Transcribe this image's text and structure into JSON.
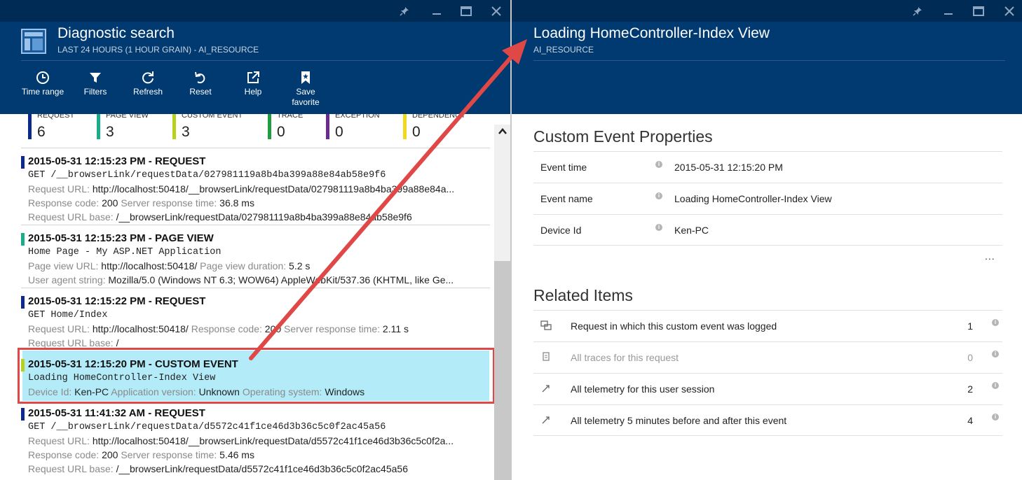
{
  "left_blade": {
    "title": "Diagnostic search",
    "subtitle": "LAST 24 HOURS (1 HOUR GRAIN) - AI_RESOURCE",
    "window_controls": [
      "pin-icon",
      "minimize-icon",
      "maximize-icon",
      "close-icon"
    ],
    "commands": [
      {
        "label": "Time range",
        "icon": "clock-icon"
      },
      {
        "label": "Filters",
        "icon": "funnel-icon"
      },
      {
        "label": "Refresh",
        "icon": "refresh-icon"
      },
      {
        "label": "Reset",
        "icon": "undo-icon"
      },
      {
        "label": "Help",
        "icon": "external-link-icon"
      },
      {
        "label": "Save favorite",
        "icon": "bookmark-star-icon"
      }
    ],
    "tiles": [
      {
        "label": "REQUEST",
        "count": "6",
        "color": "#0c2a8c"
      },
      {
        "label": "PAGE VIEW",
        "count": "3",
        "color": "#1aad8d"
      },
      {
        "label": "CUSTOM EVENT",
        "count": "3",
        "color": "#b8d11f"
      },
      {
        "label": "TRACE",
        "count": "0",
        "color": "#1f9e3f"
      },
      {
        "label": "EXCEPTION",
        "count": "0",
        "color": "#6b2b8f"
      },
      {
        "label": "DEPENDENCY",
        "count": "0",
        "color": "#f2d81d"
      }
    ],
    "results": [
      {
        "title": "2015-05-31 12:15:23 PM - REQUEST",
        "color": "#0c2a8c",
        "line1": "GET /__browserLink/requestData/027981119a8b4ba399a88e84ab58e9f6",
        "line2_k1": "Request URL: ",
        "line2_v1": "http://localhost:50418/__browserLink/requestData/027981119a8b4ba399a88e84a...",
        "line3_k1": "Response code: ",
        "line3_v1": "200",
        "line3_k2": " Server response time: ",
        "line3_v2": "36.8 ms",
        "line4_k1": "Request URL base: ",
        "line4_v1": "/__browserLink/requestData/027981119a8b4ba399a88e84ab58e9f6"
      },
      {
        "title": "2015-05-31 12:15:23 PM - PAGE VIEW",
        "color": "#1aad8d",
        "line1": "Home Page - My ASP.NET Application",
        "line2_k1": "Page view URL: ",
        "line2_v1": "http://localhost:50418/",
        "line2_k2": " Page view duration: ",
        "line2_v2": "5.2 s",
        "line3_k1": "User agent string: ",
        "line3_v1": "Mozilla/5.0 (Windows NT 6.3; WOW64) AppleWebKit/537.36 (KHTML, like Ge..."
      },
      {
        "title": "2015-05-31 12:15:22 PM - REQUEST",
        "color": "#0c2a8c",
        "line1": "GET Home/Index",
        "line2_k1": "Request URL: ",
        "line2_v1": "http://localhost:50418/",
        "line2_k2": " Response code: ",
        "line2_v2": "200",
        "line2_k3": " Server response time: ",
        "line2_v3": "2.11 s",
        "line3_k1": "Request URL base: ",
        "line3_v1": "/"
      },
      {
        "title": "2015-05-31 12:15:20 PM - CUSTOM EVENT",
        "color": "#b8d11f",
        "line1": "Loading HomeController-Index View",
        "line2_k1": "Device Id: ",
        "line2_v1": "Ken-PC",
        "line2_k2": " Application version: ",
        "line2_v2": "Unknown",
        "line2_k3": " Operating system: ",
        "line2_v3": "Windows"
      },
      {
        "title": "2015-05-31 11:41:32 AM - REQUEST",
        "color": "#0c2a8c",
        "line1": "GET /__browserLink/requestData/d5572c41f1ce46d3b36c5c0f2ac45a56",
        "line2_k1": "Request URL: ",
        "line2_v1": "http://localhost:50418/__browserLink/requestData/d5572c41f1ce46d3b36c5c0f2a...",
        "line3_k1": "Response code: ",
        "line3_v1": "200",
        "line3_k2": " Server response time: ",
        "line3_v2": "5.46 ms",
        "line4_k1": "Request URL base: ",
        "line4_v1": "/__browserLink/requestData/d5572c41f1ce46d3b36c5c0f2ac45a56"
      }
    ]
  },
  "right_blade": {
    "title": "Loading HomeController-Index View",
    "subtitle": "AI_RESOURCE",
    "properties_title": "Custom Event Properties",
    "properties": [
      {
        "key": "Event time",
        "value": "2015-05-31 12:15:20 PM"
      },
      {
        "key": "Event name",
        "value": "Loading HomeController-Index View"
      },
      {
        "key": "Device Id",
        "value": "Ken-PC"
      }
    ],
    "more_label": "...",
    "related_title": "Related Items",
    "related": [
      {
        "label": "Request in which this custom event was logged",
        "count": "1",
        "icon": "request-link-icon"
      },
      {
        "label": "All traces for this request",
        "count": "0",
        "icon": "document-icon"
      },
      {
        "label": "All telemetry for this user session",
        "count": "2",
        "icon": "diagonal-arrow-icon"
      },
      {
        "label": "All telemetry 5 minutes before and after this event",
        "count": "4",
        "icon": "diagonal-arrow-icon"
      }
    ]
  },
  "info_glyph": "i",
  "colors": {
    "header": "#003a70",
    "titlebar": "#002b55",
    "selection": "#b3ecf8",
    "annotation": "#e04848"
  }
}
